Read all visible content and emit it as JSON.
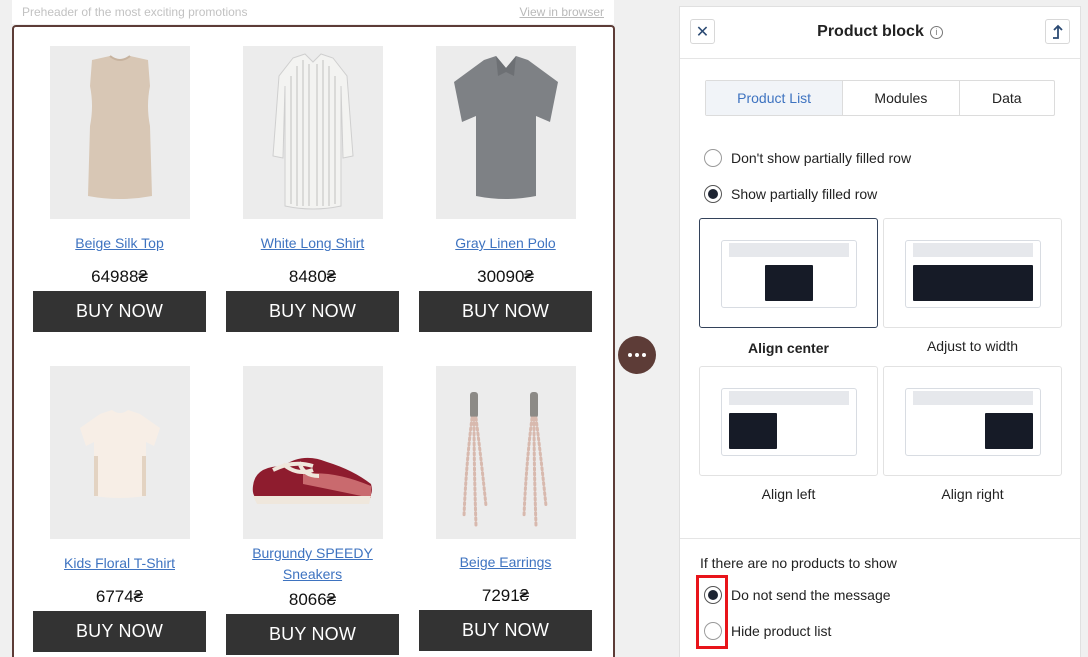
{
  "preheader": {
    "text": "Preheader of the most exciting promotions",
    "view_in_browser": "View in browser"
  },
  "products": [
    {
      "name": "Beige Silk Top",
      "price": "64988₴",
      "buy_label": "BUY NOW",
      "icon": "beige-top-image"
    },
    {
      "name": "White Long Shirt",
      "price": "8480₴",
      "buy_label": "BUY NOW",
      "icon": "white-shirt-image"
    },
    {
      "name": "Gray Linen Polo",
      "price": "30090₴",
      "buy_label": "BUY NOW",
      "icon": "gray-polo-image"
    },
    {
      "name": "Kids Floral T-Shirt",
      "price": "6774₴",
      "buy_label": "BUY NOW",
      "icon": "kids-tshirt-image"
    },
    {
      "name": "Burgundy SPEEDY Sneakers",
      "name_line1": "Burgundy SPEEDY",
      "name_line2": "Sneakers",
      "price": "8066₴",
      "buy_label": "BUY NOW",
      "icon": "sneakers-image"
    },
    {
      "name": "Beige Earrings",
      "price": "7291₴",
      "buy_label": "BUY NOW",
      "icon": "earrings-image"
    }
  ],
  "panel": {
    "title": "Product block",
    "tabs": [
      "Product List",
      "Modules",
      "Data"
    ],
    "active_tab": "Product List",
    "partial_row_options": [
      {
        "label": "Don't show partially filled row",
        "checked": false
      },
      {
        "label": "Show partially filled row",
        "checked": true
      }
    ],
    "alignments": [
      {
        "label": "Align center",
        "active": true
      },
      {
        "label": "Adjust to width",
        "active": false
      },
      {
        "label": "Align left",
        "active": false
      },
      {
        "label": "Align right",
        "active": false
      }
    ],
    "no_products": {
      "title": "If there are no products to show",
      "options": [
        {
          "label": "Do not send the message",
          "checked": true
        },
        {
          "label": "Hide product list",
          "checked": false
        }
      ]
    }
  },
  "colors": {
    "accent": "#3e73c0",
    "brand": "#5d3c37",
    "button": "#333333",
    "highlight": "#e8141a"
  }
}
